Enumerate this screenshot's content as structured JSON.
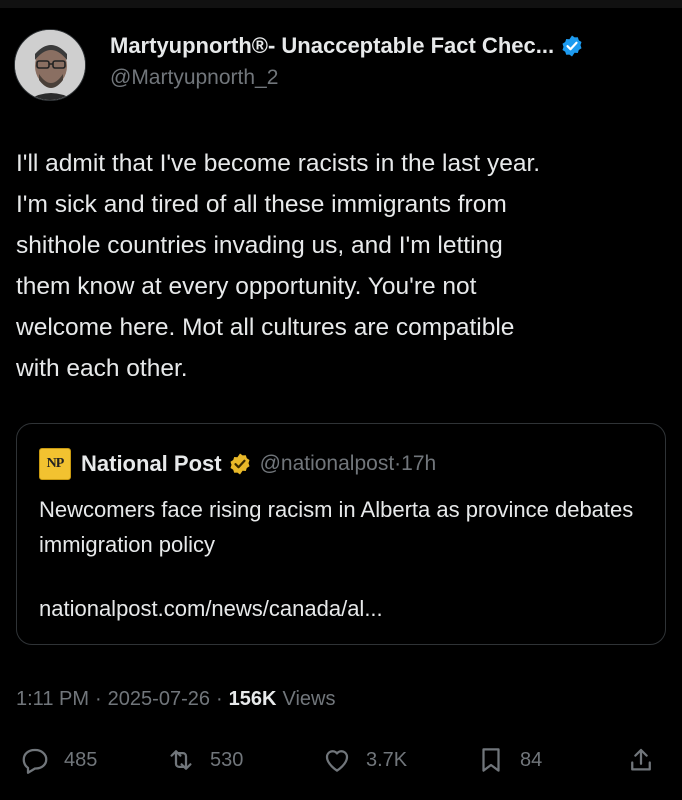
{
  "author": {
    "display_name": "Martyupnorth®- Unacceptable Fact Chec...",
    "handle": "@Martyupnorth_2",
    "verified": true
  },
  "post": {
    "text": "I'll admit that I've become racists in the last year.\nI'm sick and tired of all these immigrants from\nshithole countries invading us, and I'm letting\nthem know at every opportunity.  You're not\nwelcome here.  Mot all cultures are compatible\nwith each other."
  },
  "quote": {
    "logo_text": "NP",
    "name": "National Post",
    "handle": "@nationalpost",
    "separator": "·",
    "time": "17h",
    "text": "Newcomers face rising racism in Alberta as province debates immigration policy",
    "link": "nationalpost.com/news/canada/al..."
  },
  "meta": {
    "time": "1:11 PM",
    "sep1": "·",
    "date": "2025-07-26",
    "sep2": "·",
    "views_count": "156K",
    "views_label": "Views"
  },
  "actions": {
    "replies": "485",
    "reposts": "530",
    "likes": "3.7K",
    "bookmarks": "84"
  },
  "colors": {
    "background": "#000000",
    "text": "#e7e9ea",
    "secondary": "#71767b",
    "border": "#2f3336",
    "verified_blue": "#1d9bf0",
    "verified_gold": "#e8b829"
  }
}
